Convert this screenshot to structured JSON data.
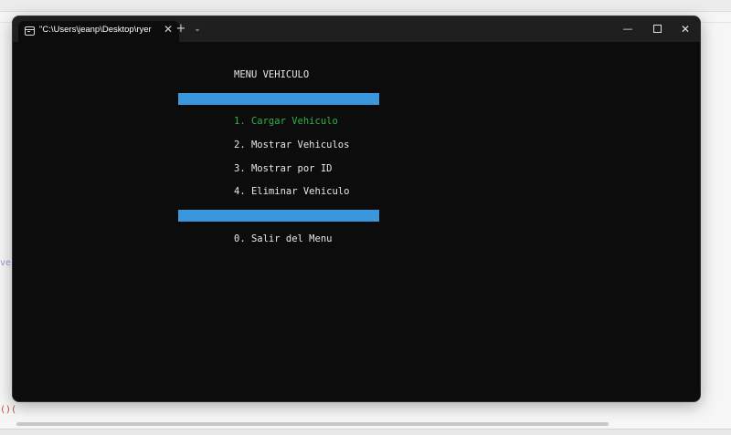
{
  "background": {
    "left_text": "ves",
    "bottom_text": "()("
  },
  "terminal": {
    "tab": {
      "title": "\"C:\\Users\\jeanp\\Desktop\\ryer",
      "icon": "terminal-icon",
      "close_glyph": "✕"
    },
    "new_tab_glyph": "+",
    "dropdown_glyph": "⌄",
    "window_controls": {
      "minimize_glyph": "—",
      "close_glyph": "✕"
    }
  },
  "menu": {
    "title": "MENU VEHICULO",
    "options": [
      {
        "label": "1. Cargar Vehiculo",
        "highlighted": true
      },
      {
        "label": "2. Mostrar Vehiculos",
        "highlighted": false
      },
      {
        "label": "3. Mostrar por ID",
        "highlighted": false
      },
      {
        "label": "4. Eliminar Vehiculo",
        "highlighted": false
      }
    ],
    "exit_option": "0. Salir del Menu"
  },
  "colors": {
    "console_background": "#0c0c0c",
    "text": "#e8e8e8",
    "highlight": "#2db34a",
    "separator": "#3a96dd",
    "titlebar": "#1f1f1f"
  }
}
